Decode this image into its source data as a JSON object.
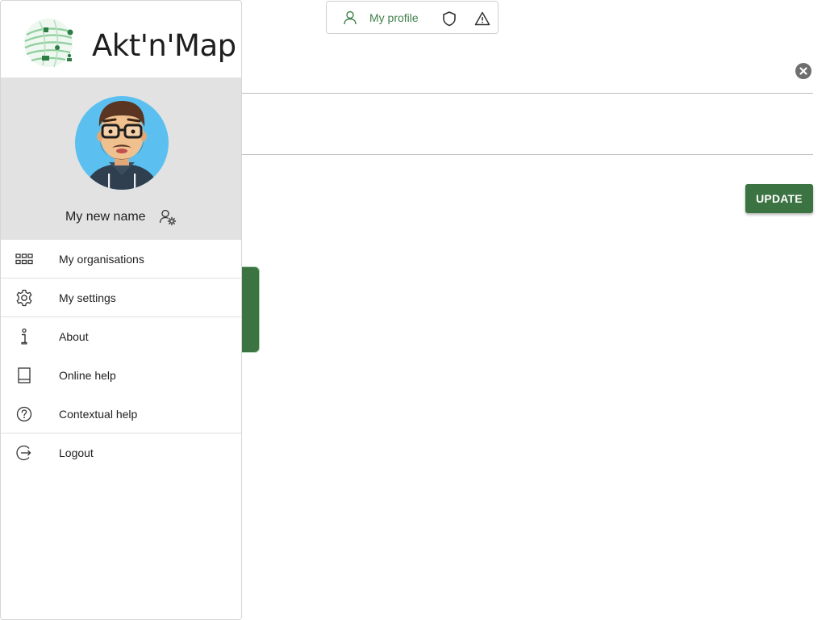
{
  "app": {
    "name": "Akt'n'Map"
  },
  "user": {
    "display_name": "My new name"
  },
  "topbar": {
    "profile_label": "My profile"
  },
  "content": {
    "update_label": "UPDATE"
  },
  "menu": [
    {
      "label": "My organisations",
      "icon": "grid-icon"
    },
    {
      "label": "My settings",
      "icon": "gear-icon"
    },
    {
      "label": "About",
      "icon": "info-icon"
    },
    {
      "label": "Online help",
      "icon": "book-icon"
    },
    {
      "label": "Contextual help",
      "icon": "question-circle-icon"
    },
    {
      "label": "Logout",
      "icon": "logout-icon"
    }
  ],
  "colors": {
    "accent_green": "#3c7342",
    "profile_text_green": "#3f7f48",
    "profile_bg": "#e2e2e2",
    "avatar_bg": "#5bc0f0"
  }
}
